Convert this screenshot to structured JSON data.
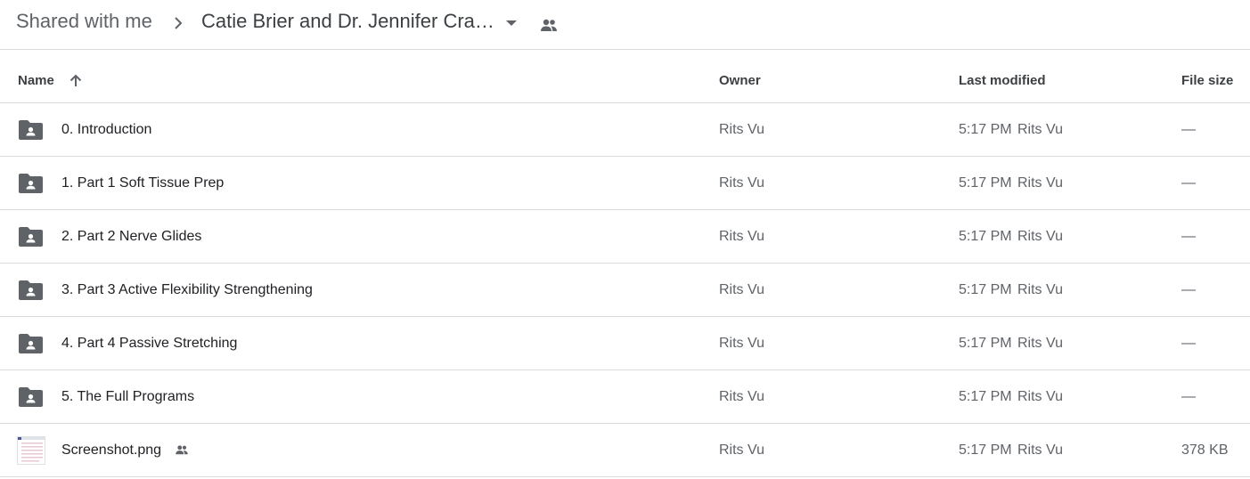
{
  "breadcrumb": {
    "root": "Shared with me",
    "current": "Catie Brier and Dr. Jennifer Crane"
  },
  "columns": {
    "name": "Name",
    "owner": "Owner",
    "last_modified": "Last modified",
    "file_size": "File size"
  },
  "files": [
    {
      "name": "0. Introduction",
      "type": "shared-folder",
      "owner": "Rits Vu",
      "modified_time": "5:17 PM",
      "modified_by": "Rits Vu",
      "size": "—"
    },
    {
      "name": "1. Part 1 Soft Tissue Prep",
      "type": "shared-folder",
      "owner": "Rits Vu",
      "modified_time": "5:17 PM",
      "modified_by": "Rits Vu",
      "size": "—"
    },
    {
      "name": "2. Part 2 Nerve Glides",
      "type": "shared-folder",
      "owner": "Rits Vu",
      "modified_time": "5:17 PM",
      "modified_by": "Rits Vu",
      "size": "—"
    },
    {
      "name": "3. Part 3 Active Flexibility Strengthening",
      "type": "shared-folder",
      "owner": "Rits Vu",
      "modified_time": "5:17 PM",
      "modified_by": "Rits Vu",
      "size": "—"
    },
    {
      "name": "4. Part 4 Passive Stretching",
      "type": "shared-folder",
      "owner": "Rits Vu",
      "modified_time": "5:17 PM",
      "modified_by": "Rits Vu",
      "size": "—"
    },
    {
      "name": "5. The Full Programs",
      "type": "shared-folder",
      "owner": "Rits Vu",
      "modified_time": "5:17 PM",
      "modified_by": "Rits Vu",
      "size": "—"
    },
    {
      "name": "Screenshot.png",
      "type": "image",
      "owner": "Rits Vu",
      "modified_time": "5:17 PM",
      "modified_by": "Rits Vu",
      "size": "378 KB"
    }
  ],
  "icons": {
    "breadcrumb_separator": "chevron-right-icon",
    "dropdown": "caret-down-icon",
    "shared": "people-icon",
    "sort": "arrow-up-icon",
    "folder": "shared-folder-icon",
    "image": "image-thumbnail-icon"
  },
  "colors": {
    "icon_gray": "#5f6368",
    "divider": "#dadce0",
    "text_primary": "#202124"
  }
}
